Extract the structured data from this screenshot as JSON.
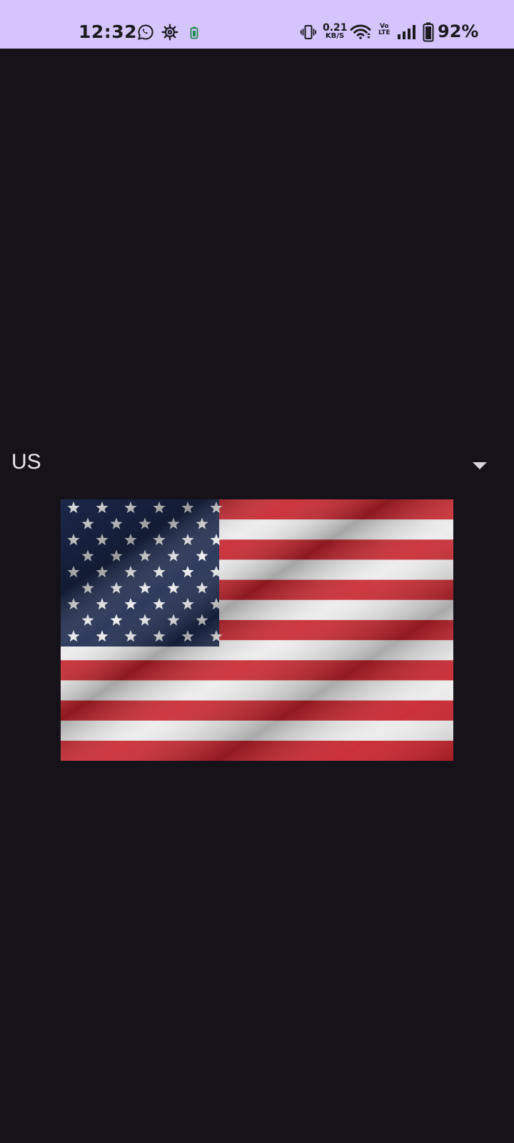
{
  "status_bar": {
    "time": "12:32",
    "net_speed_value": "0.21",
    "net_speed_unit": "KB/S",
    "volte_top": "Vo",
    "volte_bottom": "LTE",
    "battery_percent": "92%",
    "icons": [
      "whatsapp-icon",
      "settings-gear-icon",
      "battery-saver-icon",
      "vibrate-icon",
      "wifi-icon",
      "signal-icon",
      "battery-icon"
    ]
  },
  "country_selector": {
    "selected": "US"
  },
  "flag": {
    "alt": "United States flag",
    "colors": {
      "red": "#c8232c",
      "white": "#ececec",
      "blue": "#1d2a4f"
    }
  },
  "colors": {
    "background": "#15121a",
    "status_bar": "#d6c4ff",
    "text": "#ece6f0"
  }
}
